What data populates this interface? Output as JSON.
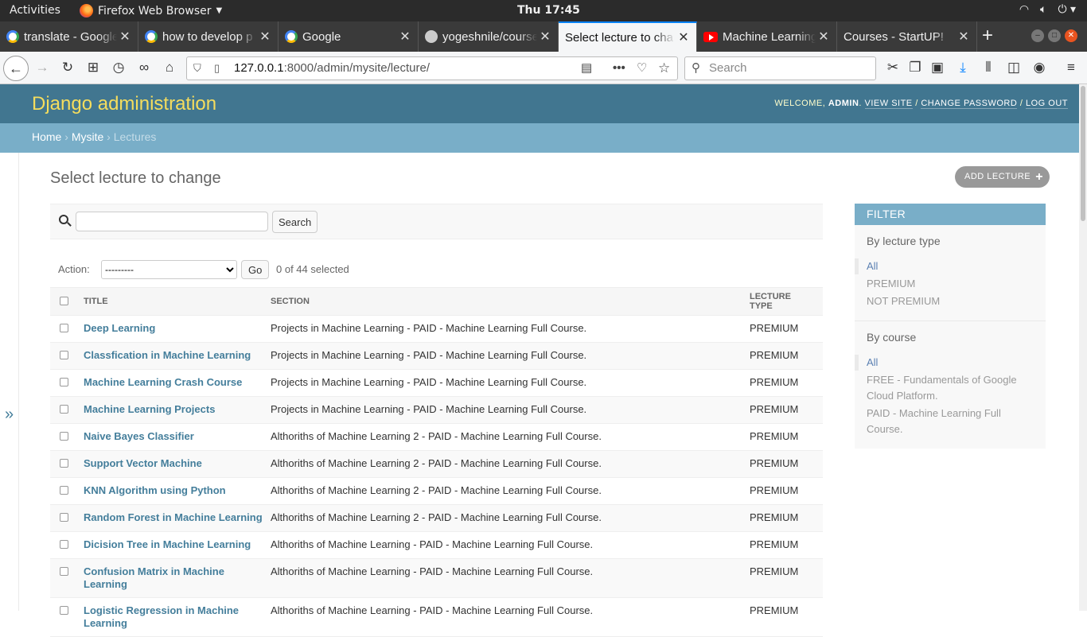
{
  "os": {
    "activities": "Activities",
    "app_name": "Firefox Web Browser",
    "clock": "Thu 17:45"
  },
  "tabs": [
    {
      "title": "translate - Google",
      "icon": "google-icon"
    },
    {
      "title": "how to develop p",
      "icon": "google-icon"
    },
    {
      "title": "Google",
      "icon": "google-icon"
    },
    {
      "title": "yogeshnile/course",
      "icon": "github-icon"
    },
    {
      "title": "Select lecture to cha",
      "icon": "none"
    },
    {
      "title": "Machine Learning",
      "icon": "youtube-icon"
    },
    {
      "title": "Courses - StartUP!",
      "icon": "none"
    }
  ],
  "browser": {
    "url_host": "127.0.0.1",
    "url_path": ":8000/admin/mysite/lecture/",
    "search_placeholder": "Search"
  },
  "django": {
    "branding": "Django administration",
    "welcome": "WELCOME,",
    "user": "ADMIN",
    "view_site": "VIEW SITE",
    "change_password": "CHANGE PASSWORD",
    "log_out": "LOG OUT",
    "breadcrumbs": {
      "home": "Home",
      "app": "Mysite",
      "current": "Lectures"
    },
    "page_title": "Select lecture to change",
    "add_button": "ADD LECTURE",
    "search_button": "Search",
    "action_label": "Action:",
    "action_selected": "---------",
    "go_button": "Go",
    "selection_count": "0 of 44 selected",
    "columns": [
      "TITLE",
      "SECTION",
      "LECTURE TYPE"
    ]
  },
  "rows": [
    {
      "title": "Deep Learning",
      "section": "Projects in Machine Learning - PAID - Machine Learning Full Course.",
      "type": "PREMIUM"
    },
    {
      "title": "Classfication in Machine Learning",
      "section": "Projects in Machine Learning - PAID - Machine Learning Full Course.",
      "type": "PREMIUM"
    },
    {
      "title": "Machine Learning Crash Course",
      "section": "Projects in Machine Learning - PAID - Machine Learning Full Course.",
      "type": "PREMIUM"
    },
    {
      "title": "Machine Learning Projects",
      "section": "Projects in Machine Learning - PAID - Machine Learning Full Course.",
      "type": "PREMIUM"
    },
    {
      "title": "Naive Bayes Classifier",
      "section": "Althoriths of Machine Learning 2 - PAID - Machine Learning Full Course.",
      "type": "PREMIUM"
    },
    {
      "title": "Support Vector Machine",
      "section": "Althoriths of Machine Learning 2 - PAID - Machine Learning Full Course.",
      "type": "PREMIUM"
    },
    {
      "title": "KNN Algorithm using Python",
      "section": "Althoriths of Machine Learning 2 - PAID - Machine Learning Full Course.",
      "type": "PREMIUM"
    },
    {
      "title": "Random Forest in Machine Learning",
      "section": "Althoriths of Machine Learning 2 - PAID - Machine Learning Full Course.",
      "type": "PREMIUM"
    },
    {
      "title": "Dicision Tree in Machine Learning",
      "section": "Althoriths of Machine Learning - PAID - Machine Learning Full Course.",
      "type": "PREMIUM"
    },
    {
      "title": "Confusion Matrix in Machine Learning",
      "section": "Althoriths of Machine Learning - PAID - Machine Learning Full Course.",
      "type": "PREMIUM"
    },
    {
      "title": "Logistic Regression in Machine Learning",
      "section": "Althoriths of Machine Learning - PAID - Machine Learning Full Course.",
      "type": "PREMIUM"
    }
  ],
  "filter": {
    "title": "FILTER",
    "groups": [
      {
        "heading": "By lecture type",
        "options": [
          "All",
          "PREMIUM",
          "NOT PREMIUM"
        ]
      },
      {
        "heading": "By course",
        "options": [
          "All",
          "FREE - Fundamentals of Google Cloud Platform.",
          "PAID - Machine Learning Full Course."
        ]
      }
    ]
  },
  "colors": {
    "header": "#417690",
    "breadcrumbs": "#79aec8",
    "branding": "#f5dd5d",
    "link": "#447e9b"
  }
}
